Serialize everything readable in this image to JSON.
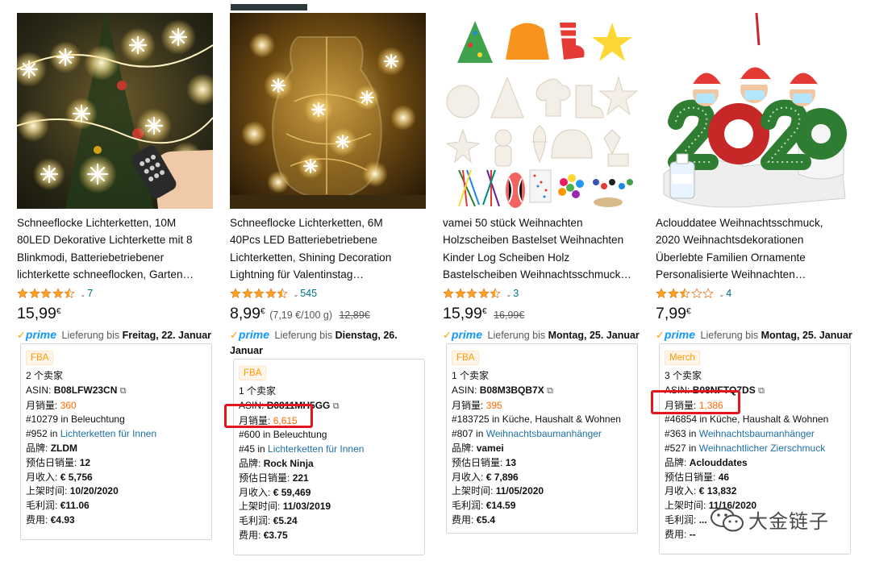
{
  "watermark": "大金链子",
  "products": [
    {
      "title_lines": [
        "Schneeflocke Lichterketten, 10M",
        "80LED Dekorative Lichterkette mit 8",
        "Blinkmodi, Batteriebetriebener",
        "lichterkette schneeflocken, Garten…"
      ],
      "rating_stars": 4.5,
      "reviews": "7",
      "price_main": "15,99",
      "price_sup": "€",
      "unit_price": "",
      "old_price": "",
      "prime_label": "prime",
      "delivery_prefix": "Lieferung bis",
      "delivery_date": "Freitag, 22. Januar",
      "ext": {
        "tag": "FBA",
        "sellers": "2 个卖家",
        "asin_label": "ASIN:",
        "asin": "B08LFW23CN",
        "monthly_sales_label": "月销量:",
        "monthly_sales": "360",
        "rank1": "#10279 in Beleuchtung",
        "rank2_num": "#952 in",
        "rank2_cat": "Lichterketten für Innen",
        "rank3_num": "",
        "rank3_cat": "",
        "brand_label": "品牌:",
        "brand": "ZLDM",
        "daily_label": "预估日销量:",
        "daily": "12",
        "revenue_label": "月收入:",
        "revenue": "€ 5,756",
        "listed_label": "上架时间:",
        "listed": "10/20/2020",
        "profit_label": "毛利润:",
        "profit": "€11.06",
        "fee_label": "费用:",
        "fee": "€4.93"
      }
    },
    {
      "title_lines": [
        "Schneeflocke Lichterketten, 6M",
        "40Pcs LED Batteriebetriebene",
        "Lichterketten, Shining Decoration",
        "Lightning für Valentinstag…"
      ],
      "rating_stars": 4.5,
      "reviews": "545",
      "price_main": "8,99",
      "price_sup": "€",
      "unit_price": "(7,19 €/100 g)",
      "old_price": "12,89€",
      "prime_label": "prime",
      "delivery_prefix": "Lieferung bis",
      "delivery_date": "Dienstag, 26.",
      "delivery_date2": "Januar",
      "ext": {
        "tag": "FBA",
        "sellers": "1 个卖家",
        "asin_label": "ASIN:",
        "asin": "B0811MH5GG",
        "monthly_sales_label": "月销量:",
        "monthly_sales": "6,615",
        "rank1": "#600 in Beleuchtung",
        "rank2_num": "#45 in",
        "rank2_cat": "Lichterketten für Innen",
        "rank3_num": "",
        "rank3_cat": "",
        "brand_label": "品牌:",
        "brand": "Rock Ninja",
        "daily_label": "预估日销量:",
        "daily": "221",
        "revenue_label": "月收入:",
        "revenue": "€ 59,469",
        "listed_label": "上架时间:",
        "listed": "11/03/2019",
        "profit_label": "毛利润:",
        "profit": "€5.24",
        "fee_label": "费用:",
        "fee": "€3.75"
      }
    },
    {
      "title_lines": [
        "vamei 50 stück Weihnachten",
        "Holzscheiben Bastelset Weihnachten",
        "Kinder Log Scheiben Holz",
        "Bastelscheiben Weihnachtsschmuck…"
      ],
      "rating_stars": 4.5,
      "reviews": "3",
      "price_main": "15,99",
      "price_sup": "€",
      "unit_price": "",
      "old_price": "16,99€",
      "prime_label": "prime",
      "delivery_prefix": "Lieferung bis",
      "delivery_date": "Montag, 25. Januar",
      "ext": {
        "tag": "FBA",
        "sellers": "1 个卖家",
        "asin_label": "ASIN:",
        "asin": "B08M3BQB7X",
        "monthly_sales_label": "月销量:",
        "monthly_sales": "395",
        "rank1": "#183725 in Küche, Haushalt & Wohnen",
        "rank2_num": "#807 in",
        "rank2_cat": "Weihnachtsbaumanhänger",
        "rank3_num": "",
        "rank3_cat": "",
        "brand_label": "品牌:",
        "brand": "vamei",
        "daily_label": "预估日销量:",
        "daily": "13",
        "revenue_label": "月收入:",
        "revenue": "€ 7,896",
        "listed_label": "上架时间:",
        "listed": "11/05/2020",
        "profit_label": "毛利润:",
        "profit": "€14.59",
        "fee_label": "费用:",
        "fee": "€5.4"
      }
    },
    {
      "title_lines": [
        "Aclouddatee Weihnachtsschmuck,",
        "2020 Weihnachtsdekorationen",
        "Überlebte Familien Ornamente",
        "Personalisierte Weihnachten…"
      ],
      "rating_stars": 2.5,
      "reviews": "4",
      "price_main": "7,99",
      "price_sup": "€",
      "unit_price": "",
      "old_price": "",
      "prime_label": "prime",
      "delivery_prefix": "Lieferung bis",
      "delivery_date": "Montag, 25. Januar",
      "ext": {
        "tag": "Merch",
        "sellers": "3 个卖家",
        "asin_label": "ASIN:",
        "asin": "B08NFTQ7DS",
        "monthly_sales_label": "月销量:",
        "monthly_sales": "1,386",
        "rank1": "#46854 in Küche, Haushalt & Wohnen",
        "rank2_num": "#363 in",
        "rank2_cat": "Weihnachtsbaumanhänger",
        "rank3_num": "#527 in",
        "rank3_cat": "Weihnachtlicher Zierschmuck",
        "brand_label": "品牌:",
        "brand": "Aclouddates",
        "daily_label": "预估日销量:",
        "daily": "46",
        "revenue_label": "月收入:",
        "revenue": "€ 13,832",
        "listed_label": "上架时间:",
        "listed": "11/16/2020",
        "profit_label": "毛利润:",
        "profit": "...",
        "fee_label": "费用:",
        "fee": "--"
      }
    }
  ],
  "colors": {
    "link": "#1d6fa5",
    "sales_orange": "#ff6a00",
    "star": "#ffa41c",
    "highlight": "#e2171d",
    "prime_blue": "#1399ff"
  }
}
